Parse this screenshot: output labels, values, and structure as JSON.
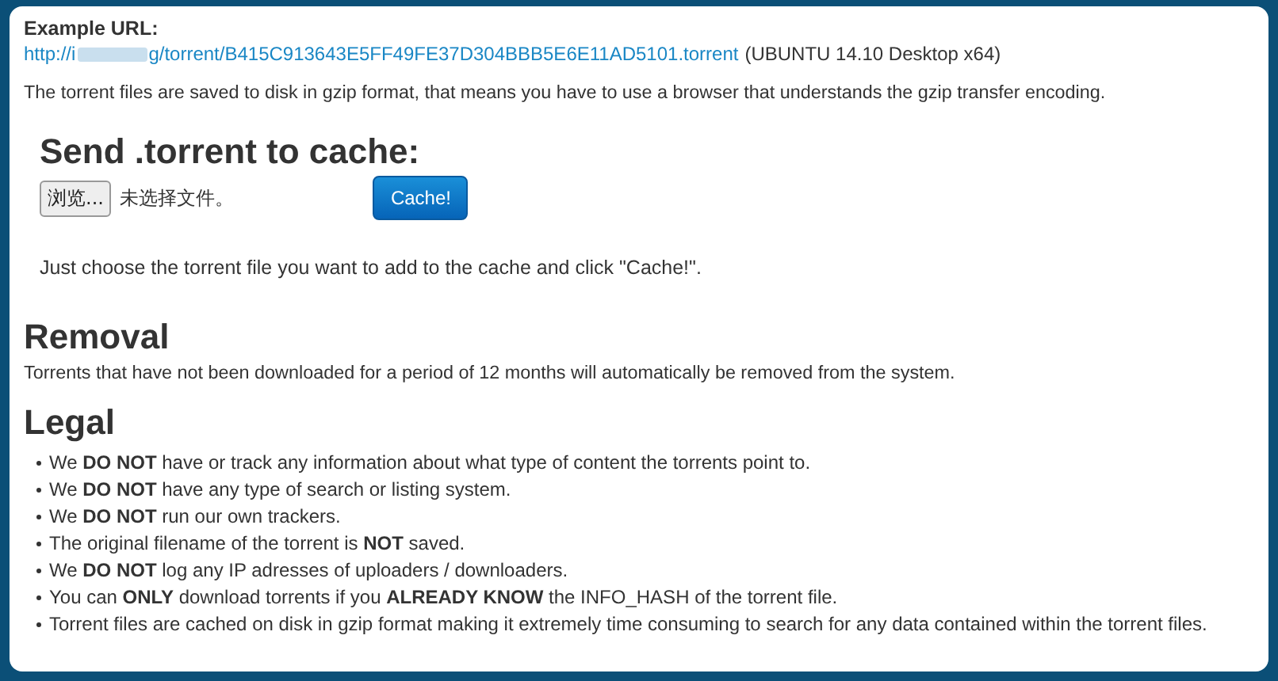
{
  "example_url": {
    "label": "Example URL:",
    "link_start": "http://i",
    "link_end": "g/torrent/B415C913643E5FF49FE37D304BBB5E6E11AD5101.torrent",
    "note": "(UBUNTU 14.10 Desktop x64)"
  },
  "intro": "The torrent files are saved to disk in gzip format, that means you have to use a browser that understands the gzip transfer encoding.",
  "upload": {
    "title": "Send .torrent to cache:",
    "browse_button": "浏览...",
    "file_status": "未选择文件。",
    "submit_button": "Cache!",
    "hint": "Just choose the torrent file you want to add to the cache and click \"Cache!\"."
  },
  "removal": {
    "title": "Removal",
    "text": "Torrents that have not been downloaded for a period of 12 months will automatically be removed from the system."
  },
  "legal": {
    "title": "Legal",
    "items": [
      "We **DO NOT** have or track any information about what type of content the torrents point to.",
      "We **DO NOT** have any type of search or listing system.",
      "We **DO NOT** run our own trackers.",
      "The original filename of the torrent is **NOT** saved.",
      "We **DO NOT** log any IP adresses of uploaders / downloaders.",
      "You can **ONLY** download torrents if you **ALREADY KNOW** the INFO_HASH of the torrent file.",
      "Torrent files are cached on disk in gzip format making it extremely time consuming to search for any data contained within the torrent files."
    ]
  }
}
